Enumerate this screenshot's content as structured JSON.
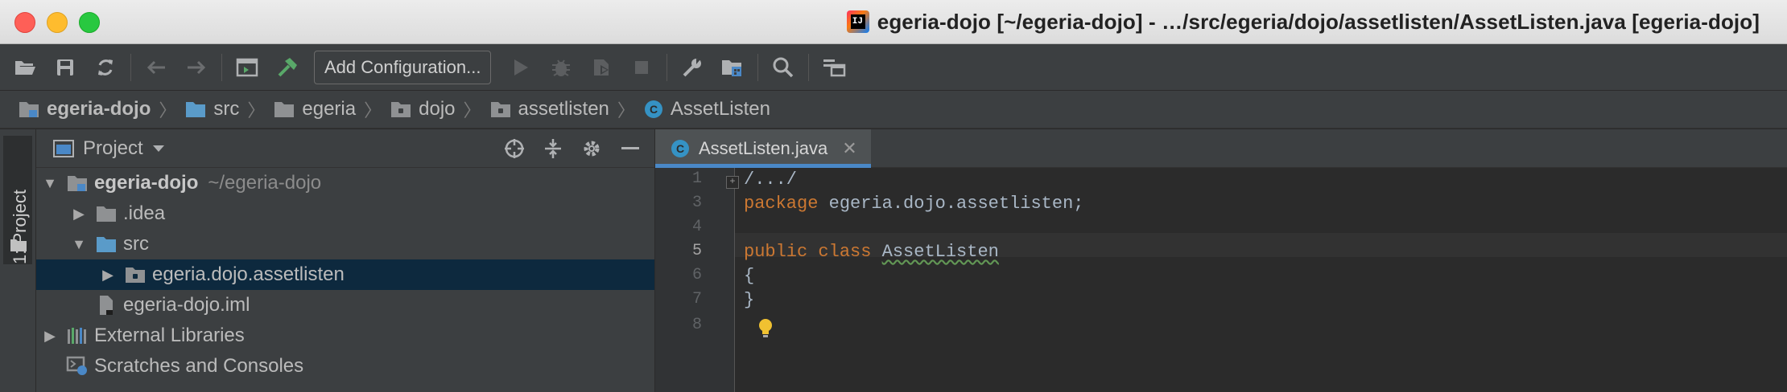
{
  "window": {
    "title": "egeria-dojo [~/egeria-dojo] - …/src/egeria/dojo/assetlisten/AssetListen.java [egeria-dojo]"
  },
  "toolbar": {
    "add_configuration_label": "Add Configuration..."
  },
  "breadcrumb": [
    {
      "label": "egeria-dojo"
    },
    {
      "label": "src"
    },
    {
      "label": "egeria"
    },
    {
      "label": "dojo"
    },
    {
      "label": "assetlisten"
    },
    {
      "label": "AssetListen"
    }
  ],
  "tool_window_stripe": {
    "project_tab_label": "1: Project"
  },
  "project_panel": {
    "title": "Project",
    "tree": [
      {
        "name": "egeria-dojo",
        "path": "~/egeria-dojo"
      },
      {
        "name": ".idea"
      },
      {
        "name": "src"
      },
      {
        "name": "egeria.dojo.assetlisten"
      },
      {
        "name": "egeria-dojo.iml"
      },
      {
        "name": "External Libraries"
      },
      {
        "name": "Scratches and Consoles"
      }
    ]
  },
  "editor": {
    "tab_label": "AssetListen.java",
    "line_numbers": [
      "1",
      "3",
      "4",
      "5",
      "6",
      "7",
      "8"
    ],
    "current_line": "5",
    "code": {
      "line1": "/.../",
      "line3_kw": "package",
      "line3_rest": " egeria.dojo.assetlisten;",
      "line5_kw": "public class",
      "line5_class": "AssetListen",
      "line6": "{",
      "line7": "}"
    }
  },
  "colors": {
    "keyword": "#cc7832",
    "text": "#a9b7c6",
    "selection": "#0d293e",
    "tab_accent": "#4a88c7",
    "folder_blue": "#5a9bc9"
  }
}
